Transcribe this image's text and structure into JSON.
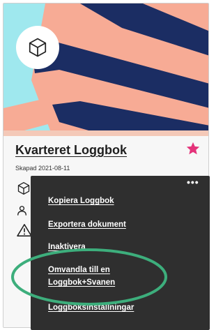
{
  "card": {
    "title": "Kvarteret Loggbok",
    "created": "Skapad 2021-08-11",
    "favorite": true,
    "colors": {
      "hero_sky": "#9fe8ee",
      "hero_pink": "#f7ab95",
      "hero_navy": "#1b2d63",
      "star": "#e4337a",
      "menu_bg": "#2f2f2f",
      "highlight": "#3dae7c"
    }
  },
  "icons": {
    "badge": "cube-icon",
    "meta": [
      "cube-icon",
      "users-icon",
      "warning-icon"
    ],
    "more": "more-icon",
    "favorite": "star-icon"
  },
  "menu": {
    "more_label": "•••",
    "items": [
      {
        "label": "Kopiera Loggbok"
      },
      {
        "label": "Exportera dokument"
      },
      {
        "label": "Inaktivera"
      },
      {
        "label": "Omvandla till en"
      },
      {
        "label": "Loggbok+Svanen"
      },
      {
        "label": "Loggboksinställningar"
      }
    ],
    "highlighted_item": "Omvandla till en Loggbok+Svanen"
  }
}
